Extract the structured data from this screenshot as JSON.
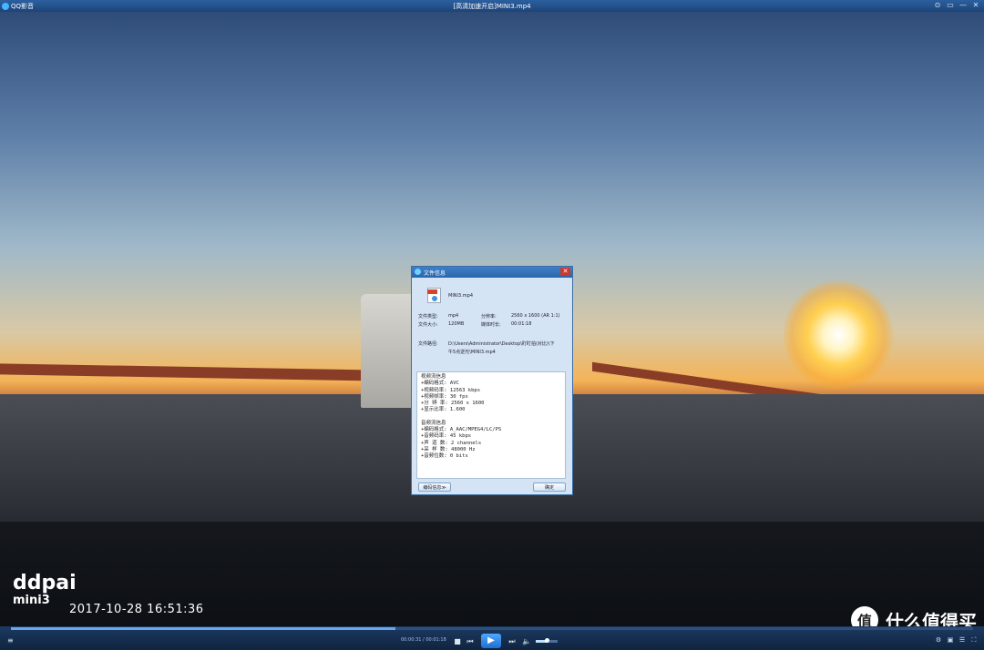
{
  "app": {
    "name": "QQ影音",
    "window_title": "[高清加速开启]MINI3.mp4"
  },
  "window_buttons": [
    "⊙",
    "▭",
    "—",
    "✕"
  ],
  "overlay": {
    "brand": "ddpai",
    "model": "mini3",
    "datetime": "2017-10-28    16:51:36",
    "corner_badge": "值",
    "corner_text": "什么值得买"
  },
  "player": {
    "time": "00:00:31 / 00:01:18",
    "progress": 0.4,
    "volume": 0.5
  },
  "dialog": {
    "title": "文件信息",
    "close": "✕",
    "file_name": "MINI3.mp4",
    "file_type_label": "文件类型:",
    "file_type": "mp4",
    "resolution_label": "分辨率:",
    "resolution": "2560 x 1600 (AR 1:1)",
    "file_size_label": "文件大小:",
    "file_size": "120MB",
    "duration_label": "媒体时长:",
    "duration": "00:01:18",
    "path_label": "文件路径:",
    "path_line1": "D:\\Users\\Administrator\\Desktop\\盯盯拍(对比)\\下",
    "path_line2": "午5点逆光\\MINI3.mp4",
    "video_header": "视频流信息",
    "video_lines": [
      "+编码格式: AVC",
      "+视频码率: 12563 kbps",
      "+视频帧率: 30 fps",
      "+分 辨 率: 2560 x 1600",
      "+显示比率: 1.600"
    ],
    "audio_header": "音频流信息",
    "audio_lines": [
      "+编码格式: A_AAC/MPEG4/LC/PS",
      "+音频码率: 45 kbps",
      "+声 道 数: 2 channels",
      "+采 样 数: 48000 Hz",
      "+音频位数: 0 bits"
    ],
    "codec_button": "编码信息≫",
    "ok_button": "确定"
  }
}
